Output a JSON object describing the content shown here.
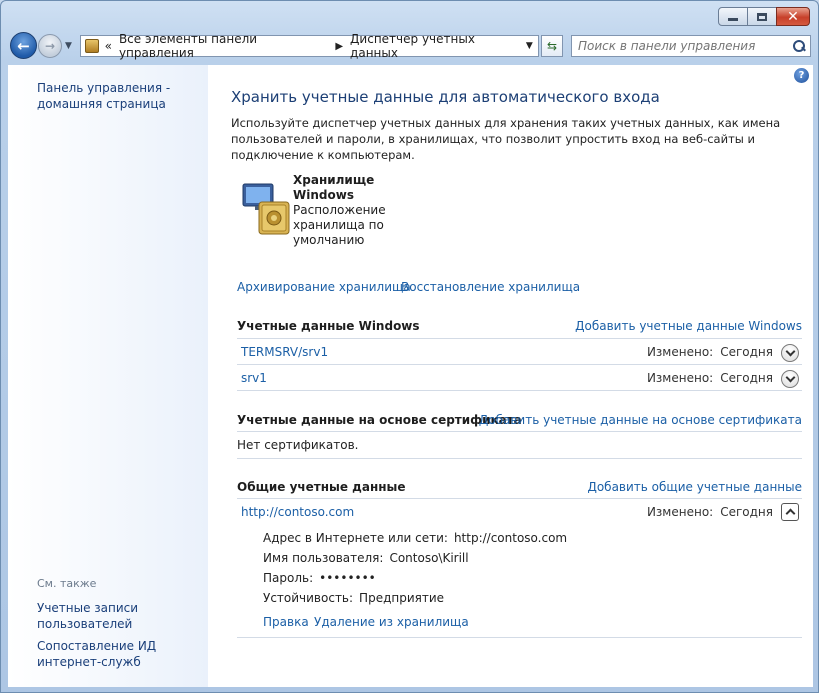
{
  "window": {
    "min_icon": "minimize-icon",
    "max_icon": "maximize-icon",
    "close_icon": "close-icon"
  },
  "nav": {
    "breadcrumb": [
      "Все элементы панели управления",
      "Диспетчер учетных данных"
    ],
    "overflow": "«",
    "search_placeholder": "Поиск в панели управления"
  },
  "sidebar": {
    "home": "Панель управления - домашняя страница",
    "see_also": "См. также",
    "links": [
      "Учетные записи пользователей",
      "Сопоставление ИД интернет-служб"
    ]
  },
  "main": {
    "title": "Хранить учетные данные для автоматического входа",
    "description": "Используйте диспетчер учетных данных для хранения таких учетных данных, как имена пользователей и пароли, в хранилищах, что позволит упростить вход на веб-сайты и подключение к компьютерам.",
    "vault": {
      "name": "Хранилище Windows",
      "location": "Расположение хранилища по умолчанию"
    },
    "backup": "Архивирование хранилища",
    "restore": "Восстановление хранилища",
    "windows_section": {
      "heading": "Учетные данные Windows",
      "add": "Добавить учетные данные Windows",
      "items": [
        {
          "name": "TERMSRV/srv1",
          "modified_label": "Изменено:",
          "modified_value": "Сегодня"
        },
        {
          "name": "srv1",
          "modified_label": "Изменено:",
          "modified_value": "Сегодня"
        }
      ]
    },
    "cert_section": {
      "heading": "Учетные данные на основе сертификата",
      "add": "Добавить учетные данные на основе сертификата",
      "empty": "Нет сертификатов."
    },
    "generic_section": {
      "heading": "Общие учетные данные",
      "add": "Добавить общие учетные данные",
      "item": {
        "name": "http://contoso.com",
        "modified_label": "Изменено:",
        "modified_value": "Сегодня",
        "address_label": "Адрес в Интернете или сети:",
        "address_value": "http://contoso.com",
        "user_label": "Имя пользователя:",
        "user_value": "Contoso\\Kirill",
        "password_label": "Пароль:",
        "password_value": "••••••••",
        "persistence_label": "Устойчивость:",
        "persistence_value": "Предприятие",
        "edit": "Правка",
        "remove": "Удаление из хранилища"
      }
    }
  }
}
